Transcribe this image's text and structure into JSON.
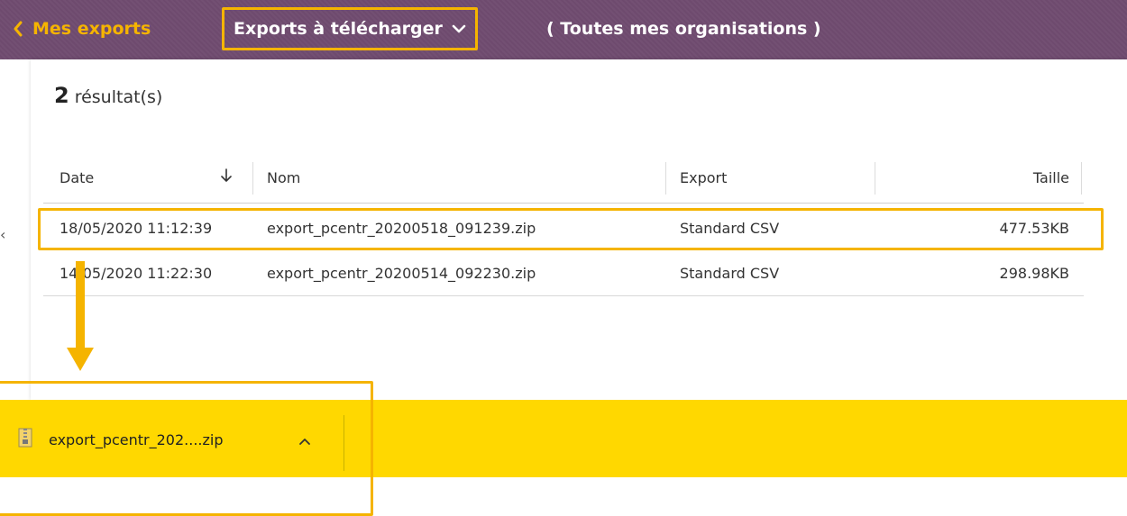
{
  "header": {
    "back_label": "Mes exports",
    "view_selector": "Exports à télécharger",
    "organisation_scope": "( Toutes mes organisations )"
  },
  "results": {
    "count": "2",
    "label": "résultat(s)"
  },
  "table": {
    "columns": [
      "Date",
      "Nom",
      "Export",
      "Taille"
    ],
    "sort_icon": "arrow-down-icon",
    "rows": [
      {
        "date": "18/05/2020 11:12:39",
        "name": "export_pcentr_20200518_091239.zip",
        "export": "Standard CSV",
        "size": "477.53KB"
      },
      {
        "date": "14/05/2020 11:22:30",
        "name": "export_pcentr_20200514_092230.zip",
        "export": "Standard CSV",
        "size": "298.98KB"
      }
    ]
  },
  "download_bar": {
    "file_label": "export_pcentr_202....zip",
    "file_icon": "zip-file-icon",
    "caret_icon": "chevron-up-icon"
  },
  "colors": {
    "header_bg": "#6e4a6e",
    "accent": "#f5b400",
    "download_bar_bg": "#ffd800"
  }
}
